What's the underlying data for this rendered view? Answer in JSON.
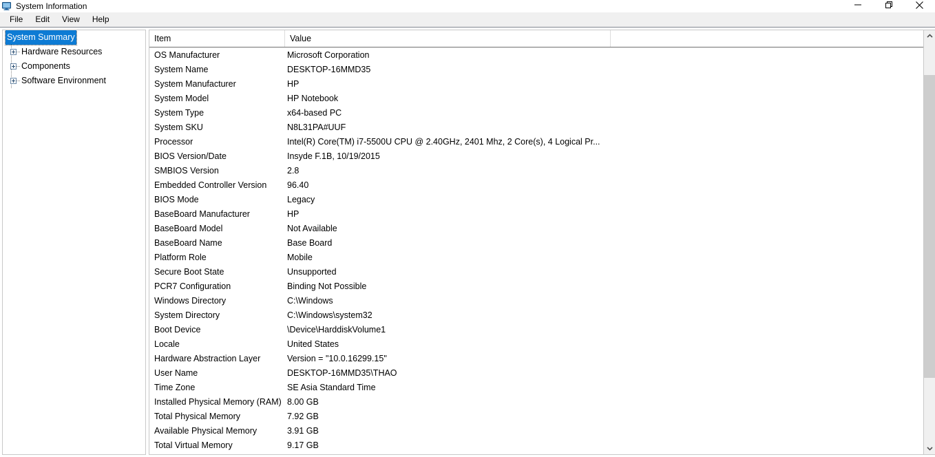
{
  "window": {
    "title": "System Information",
    "icon": "computer-icon",
    "controls": {
      "minimize": "Minimize",
      "restore": "Restore",
      "close": "Close"
    }
  },
  "menu": {
    "items": [
      {
        "label": "File"
      },
      {
        "label": "Edit"
      },
      {
        "label": "View"
      },
      {
        "label": "Help"
      }
    ]
  },
  "tree": {
    "items": [
      {
        "label": "System Summary",
        "selected": true,
        "expandable": false
      },
      {
        "label": "Hardware Resources",
        "selected": false,
        "expandable": true
      },
      {
        "label": "Components",
        "selected": false,
        "expandable": true
      },
      {
        "label": "Software Environment",
        "selected": false,
        "expandable": true
      }
    ]
  },
  "detail": {
    "columns": [
      "Item",
      "Value"
    ],
    "rows": [
      {
        "item": "OS Manufacturer",
        "value": "Microsoft Corporation"
      },
      {
        "item": "System Name",
        "value": "DESKTOP-16MMD35"
      },
      {
        "item": "System Manufacturer",
        "value": "HP"
      },
      {
        "item": "System Model",
        "value": "HP Notebook"
      },
      {
        "item": "System Type",
        "value": "x64-based PC"
      },
      {
        "item": "System SKU",
        "value": "N8L31PA#UUF"
      },
      {
        "item": "Processor",
        "value": "Intel(R) Core(TM) i7-5500U CPU @ 2.40GHz, 2401 Mhz, 2 Core(s), 4 Logical Pr..."
      },
      {
        "item": "BIOS Version/Date",
        "value": "Insyde F.1B, 10/19/2015"
      },
      {
        "item": "SMBIOS Version",
        "value": "2.8"
      },
      {
        "item": "Embedded Controller Version",
        "value": "96.40"
      },
      {
        "item": "BIOS Mode",
        "value": "Legacy"
      },
      {
        "item": "BaseBoard Manufacturer",
        "value": "HP"
      },
      {
        "item": "BaseBoard Model",
        "value": "Not Available"
      },
      {
        "item": "BaseBoard Name",
        "value": "Base Board"
      },
      {
        "item": "Platform Role",
        "value": "Mobile"
      },
      {
        "item": "Secure Boot State",
        "value": "Unsupported"
      },
      {
        "item": "PCR7 Configuration",
        "value": "Binding Not Possible"
      },
      {
        "item": "Windows Directory",
        "value": "C:\\Windows"
      },
      {
        "item": "System Directory",
        "value": "C:\\Windows\\system32"
      },
      {
        "item": "Boot Device",
        "value": "\\Device\\HarddiskVolume1"
      },
      {
        "item": "Locale",
        "value": "United States"
      },
      {
        "item": "Hardware Abstraction Layer",
        "value": "Version = \"10.0.16299.15\""
      },
      {
        "item": "User Name",
        "value": "DESKTOP-16MMD35\\THAO"
      },
      {
        "item": "Time Zone",
        "value": "SE Asia Standard Time"
      },
      {
        "item": "Installed Physical Memory (RAM)",
        "value": "8.00 GB"
      },
      {
        "item": "Total Physical Memory",
        "value": "7.92 GB"
      },
      {
        "item": "Available Physical Memory",
        "value": "3.91 GB"
      },
      {
        "item": "Total Virtual Memory",
        "value": "9.17 GB"
      }
    ]
  },
  "scrollbar": {
    "up_icon": "chevron-up-icon",
    "down_icon": "chevron-down-icon"
  },
  "colors": {
    "selection": "#0d7bd4",
    "menubar_bg": "#f0f0f0",
    "border": "#c8c8c8",
    "scroll_thumb": "#cdcdcd"
  }
}
